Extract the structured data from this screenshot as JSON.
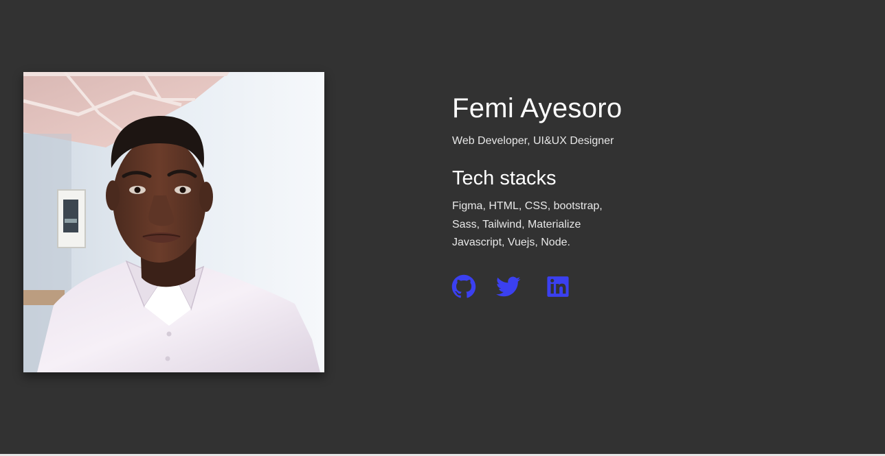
{
  "profile": {
    "name": "Femi Ayesoro",
    "role": "Web Developer, UI&UX Designer",
    "photo_alt": "Femi Ayesoro"
  },
  "tech_stacks": {
    "heading": "Tech stacks",
    "lines": [
      "Figma, HTML, CSS, bootstrap,",
      "Sass, Tailwind, Materialize",
      "Javascript, Vuejs, Node."
    ]
  },
  "socials": [
    {
      "icon": "github-icon"
    },
    {
      "icon": "twitter-icon"
    },
    {
      "icon": "linkedin-icon"
    }
  ],
  "colors": {
    "background": "#323232",
    "text": "#ffffff",
    "accent": "#3b40f0"
  }
}
